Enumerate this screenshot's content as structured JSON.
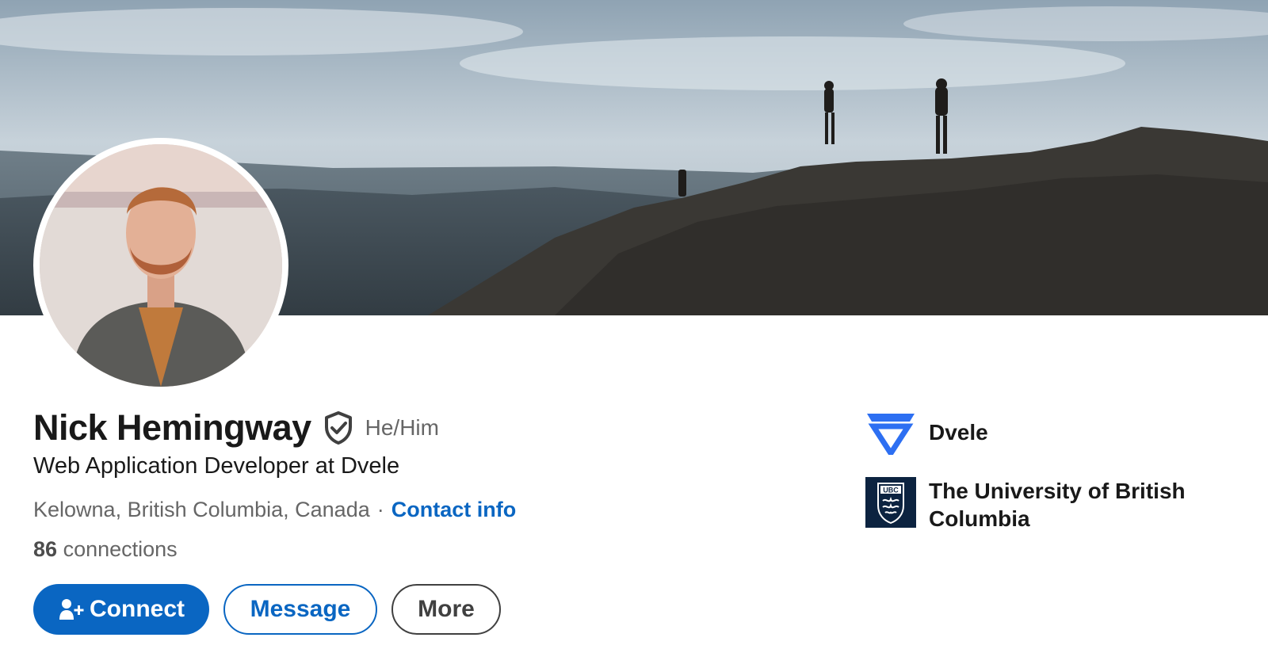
{
  "cover": {
    "icon": "mountain-cover-photo"
  },
  "profile": {
    "name": "Nick Hemingway",
    "verified_icon": "shield-check-icon",
    "pronouns": "He/Him",
    "headline": "Web Application Developer at Dvele",
    "location": "Kelowna, British Columbia, Canada",
    "separator": "·",
    "contact_label": "Contact info",
    "connections_count": "86",
    "connections_label": "connections"
  },
  "actions": {
    "connect_label": "Connect",
    "message_label": "Message",
    "more_label": "More"
  },
  "orgs": [
    {
      "name": "Dvele",
      "icon": "dvele-logo"
    },
    {
      "name": "The University of British Columbia",
      "icon": "ubc-logo",
      "logo_text": "UBC"
    }
  ],
  "colors": {
    "primary": "#0a66c2",
    "text": "#191919",
    "secondary_text": "#666666",
    "ubc_navy": "#0c2340",
    "dvele_blue": "#2d6ff2"
  }
}
